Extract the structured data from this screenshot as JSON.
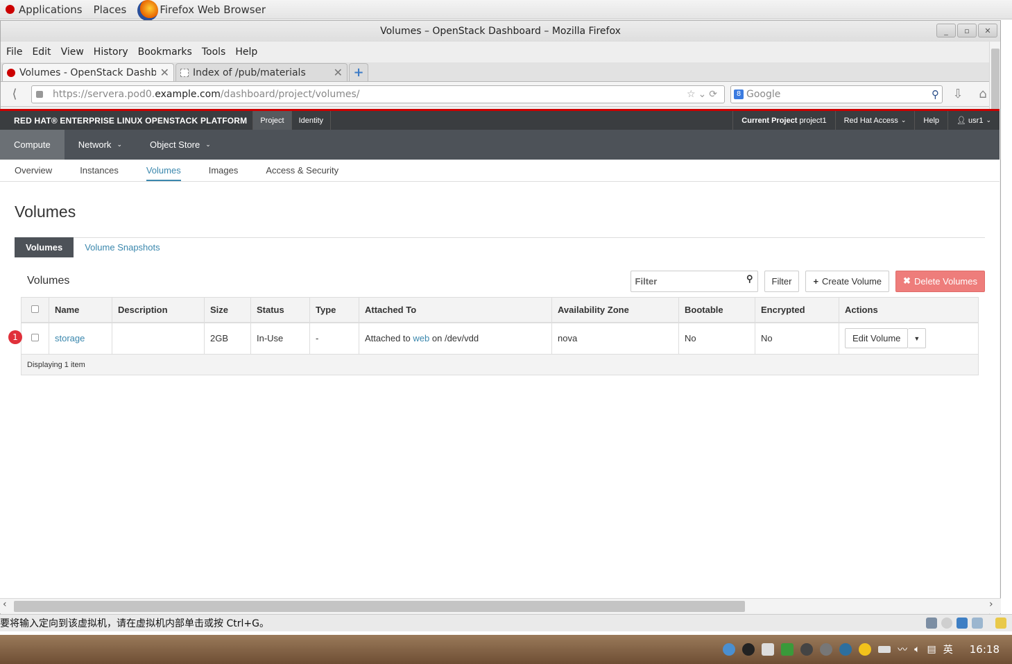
{
  "gnome_panel": {
    "applications": "Applications",
    "places": "Places",
    "active_app": "Firefox Web Browser"
  },
  "window": {
    "title": "Volumes – OpenStack Dashboard – Mozilla Firefox",
    "controls": [
      "_",
      "▫",
      "✕"
    ]
  },
  "menu": [
    "File",
    "Edit",
    "View",
    "History",
    "Bookmarks",
    "Tools",
    "Help"
  ],
  "tabs": [
    {
      "title": "Volumes - OpenStack Dashb...",
      "active": true
    },
    {
      "title": "Index of /pub/materials",
      "active": false
    }
  ],
  "urlbar": {
    "prefix": "https://servera.pod0.",
    "host": "example.com",
    "path": "/dashboard/project/volumes/"
  },
  "searchbar": {
    "placeholder": "Google"
  },
  "topnav": {
    "brand": "RED HAT® ENTERPRISE LINUX OPENSTACK PLATFORM",
    "project": "Project",
    "identity": "Identity",
    "current_project_label": "Current Project",
    "current_project_value": "project1",
    "redhat_access": "Red Hat Access",
    "help": "Help",
    "user": "usr1"
  },
  "compute_bar": {
    "compute": "Compute",
    "network": "Network",
    "object_store": "Object Store"
  },
  "subnav": [
    "Overview",
    "Instances",
    "Volumes",
    "Images",
    "Access & Security"
  ],
  "page_title": "Volumes",
  "inner_tabs": [
    "Volumes",
    "Volume Snapshots"
  ],
  "table": {
    "caption": "Volumes",
    "filter_placeholder": "Filter",
    "filter_button": "Filter",
    "create_button": "Create Volume",
    "delete_button": "Delete Volumes",
    "columns": [
      "Name",
      "Description",
      "Size",
      "Status",
      "Type",
      "Attached To",
      "Availability Zone",
      "Bootable",
      "Encrypted",
      "Actions"
    ],
    "rows": [
      {
        "name": "storage",
        "description": "",
        "size": "2GB",
        "status": "In-Use",
        "type": "-",
        "attached_prefix": "Attached to",
        "attached_instance": "web",
        "attached_suffix": "on /dev/vdd",
        "zone": "nova",
        "bootable": "No",
        "encrypted": "No",
        "action": "Edit Volume"
      }
    ],
    "footer": "Displaying 1 item",
    "row_badge": "1"
  },
  "vm_status": "要将输入定向到该虚拟机，请在虚拟机内部单击或按 Ctrl+G。",
  "taskbar": {
    "ime": "英",
    "time": "16:18"
  }
}
